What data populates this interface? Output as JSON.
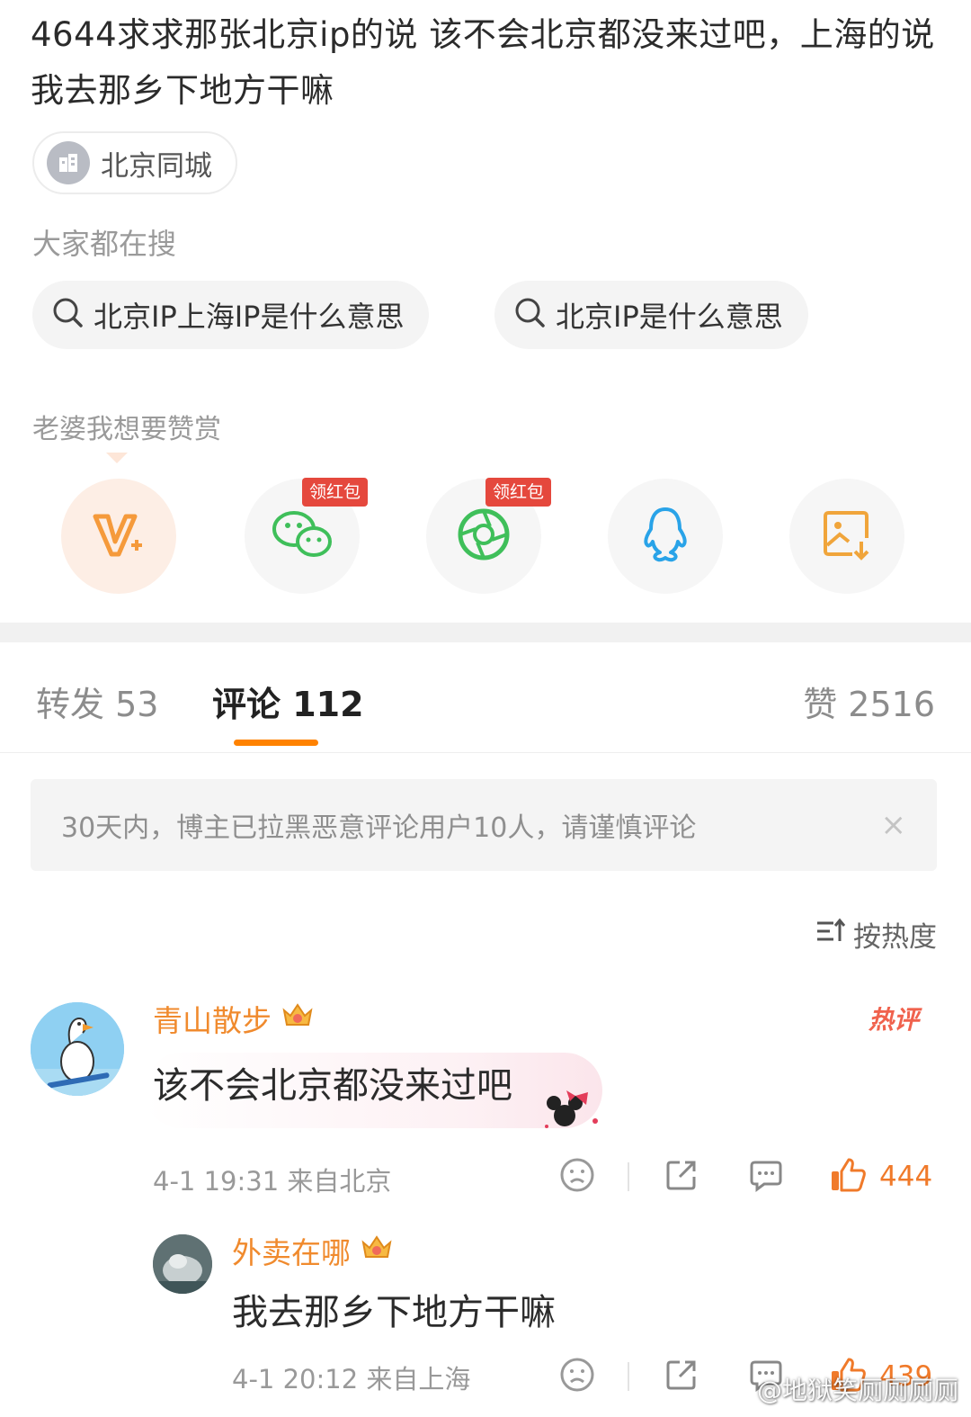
{
  "post": {
    "text": "4644求求那张北京ip的说 该不会北京都没来过吧，上海的说 我去那乡下地方干嘛",
    "topic_chip": "北京同城"
  },
  "search": {
    "title": "大家都在搜",
    "items": [
      {
        "label": "北京IP上海IP是什么意思"
      },
      {
        "label": "北京IP是什么意思"
      }
    ]
  },
  "reward": {
    "title": "老婆我想要赞赏"
  },
  "share": {
    "items": [
      {
        "icon": "vip-plus-icon"
      },
      {
        "icon": "wechat-icon",
        "badge": "领红包"
      },
      {
        "icon": "moments-icon",
        "badge": "领红包"
      },
      {
        "icon": "qq-icon"
      },
      {
        "icon": "save-image-icon"
      }
    ]
  },
  "tabs": {
    "repost": "转发 53",
    "comment": "评论 112",
    "like": "赞 2516"
  },
  "notice": {
    "text": "30天内，博主已拉黑恶意评论用户10人，请谨慎评论",
    "close": "×"
  },
  "sort": {
    "label": "按热度"
  },
  "comments": [
    {
      "username": "青山散步",
      "text": "该不会北京都没来过吧",
      "meta": "4-1 19:31  来自北京",
      "likes": "444",
      "hot_tag": "热评"
    },
    {
      "username": "外卖在哪",
      "text": "我去那乡下地方干嘛",
      "meta": "4-1 20:12  来自上海",
      "likes": "439"
    }
  ],
  "watermark": "@地狱笑厕厕厕厕",
  "colors": {
    "accent": "#ff8200",
    "username": "#f08a2d",
    "badge": "#e5483d"
  }
}
